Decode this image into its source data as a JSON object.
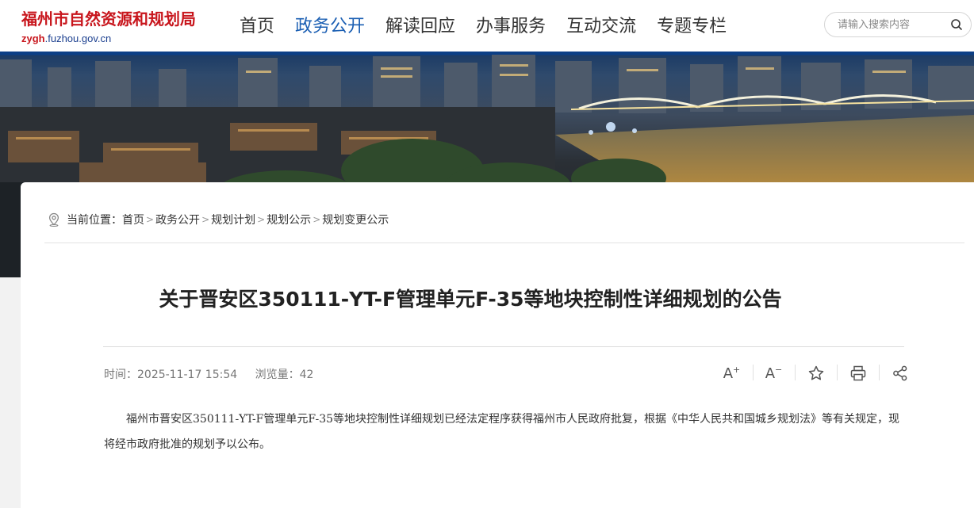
{
  "site": {
    "name": "福州市自然资源和规划局",
    "domain_prefix": "zygh",
    "domain_rest": ".fuzhou.gov.cn"
  },
  "nav": {
    "items": [
      {
        "label": "首页",
        "active": false
      },
      {
        "label": "政务公开",
        "active": true
      },
      {
        "label": "解读回应",
        "active": false
      },
      {
        "label": "办事服务",
        "active": false
      },
      {
        "label": "互动交流",
        "active": false
      },
      {
        "label": "专题专栏",
        "active": false
      }
    ]
  },
  "search": {
    "placeholder": "请输入搜索内容",
    "icon": "search-icon"
  },
  "breadcrumb": {
    "prefix": "当前位置：",
    "items": [
      "首页",
      "政务公开",
      "规划计划",
      "规划公示",
      "规划变更公示"
    ],
    "separator": ">"
  },
  "article": {
    "title": "关于晋安区350111-YT-F管理单元F-35等地块控制性详细规划的公告",
    "time_label": "时间：",
    "time": "2025-11-17 15:54",
    "views_label": "浏览量：",
    "views": "42",
    "body": "福州市晋安区350111-YT-F管理单元F-35等地块控制性详细规划已经法定程序获得福州市人民政府批复，根据《中华人民共和国城乡规划法》等有关规定，现将经市政府批准的规划予以公布。"
  },
  "tools": {
    "font_larger": "A",
    "font_larger_mark": "+",
    "font_smaller": "A",
    "font_smaller_mark": "−"
  },
  "colors": {
    "brand_red": "#c8161d",
    "nav_active": "#1b5fb3",
    "banner_blue": "#0c3f86"
  }
}
